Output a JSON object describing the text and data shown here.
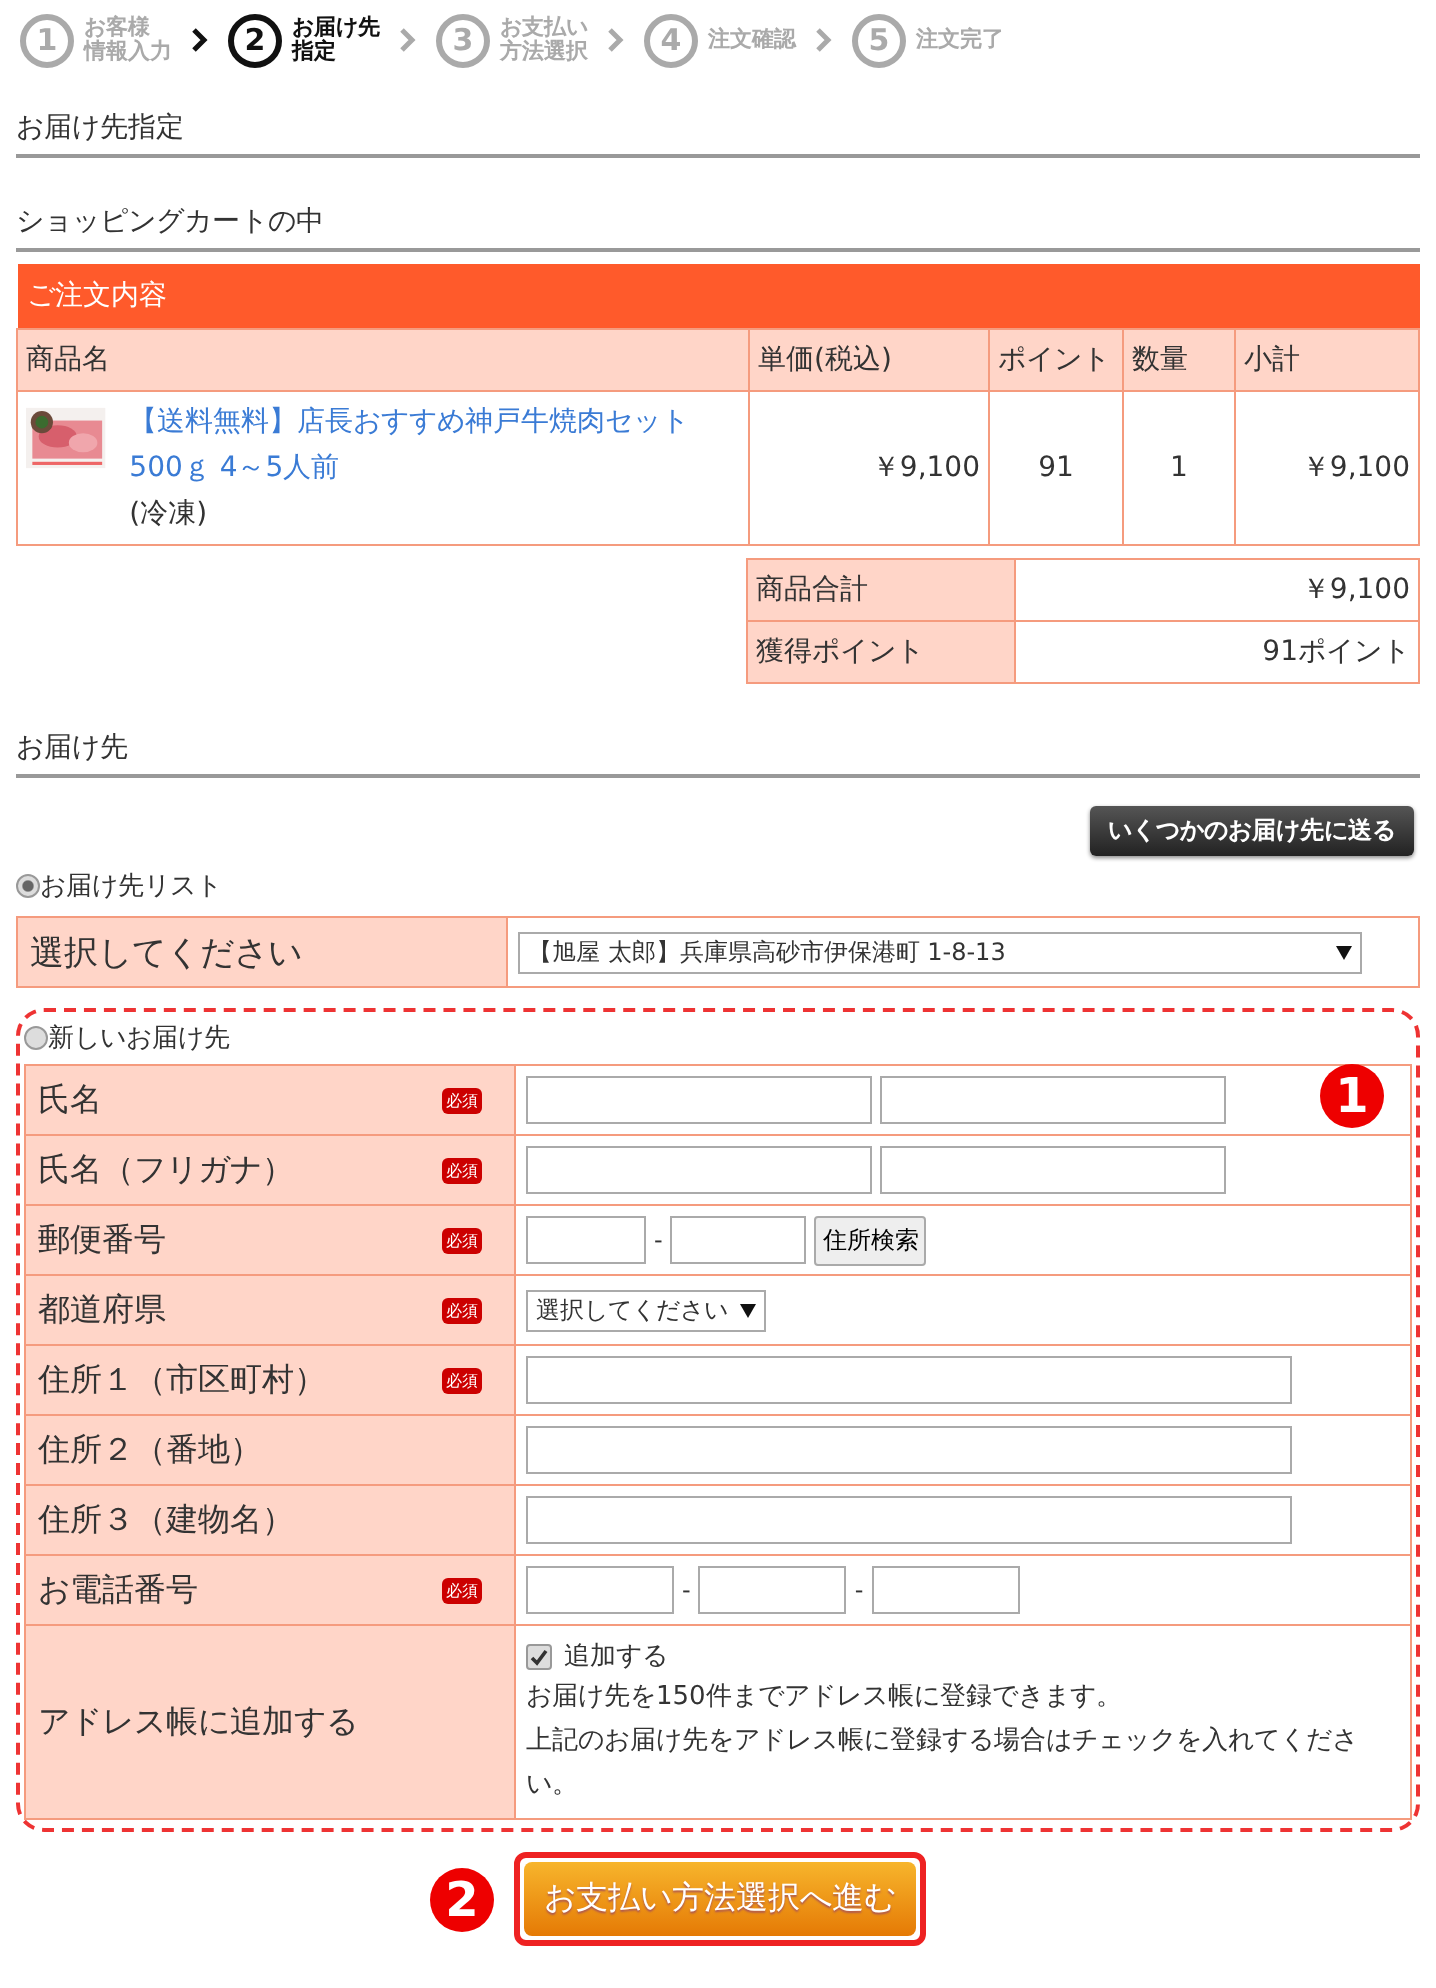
{
  "steps": [
    {
      "number": "1",
      "lines": [
        "お客様",
        "情報入力"
      ],
      "selected": false
    },
    {
      "number": "2",
      "lines": [
        "お届け先",
        "指定"
      ],
      "selected": true
    },
    {
      "number": "3",
      "lines": [
        "お支払い",
        "方法選択"
      ],
      "selected": false
    },
    {
      "number": "4",
      "lines": [
        "注文確認"
      ],
      "selected": false
    },
    {
      "number": "5",
      "lines": [
        "注文完了"
      ],
      "selected": false
    }
  ],
  "sections": [
    "お届け先指定",
    "ショッピングカートの中"
  ],
  "cart": {
    "title": "ご注文内容",
    "columns": [
      "商品名",
      "単価(税込)",
      "ポイント",
      "数量",
      "小計"
    ],
    "rows": [
      {
        "name": "【送料無料】店長おすすめ神戸牛焼肉セット500ｇ 4～5人前",
        "note": "(冷凍)",
        "price": "￥9,100",
        "points": "91",
        "quantity": "1",
        "subtotal": "￥9,100"
      }
    ],
    "summary": [
      {
        "label": "商品合計",
        "value": "￥9,100"
      },
      {
        "label": "獲得ポイント",
        "value": "91ポイント"
      }
    ]
  },
  "delivery": {
    "heading": "お届け先",
    "multi_button": "いくつかのお届け先に送る",
    "address_list": {
      "label": "お届け先リスト",
      "selected": true,
      "row_label": "選択してください",
      "value": "【旭屋 太郎】兵庫県高砂市伊保港町 1-8-13"
    },
    "new_address": {
      "label": "新しいお届け先",
      "selected": false,
      "marker": "1",
      "fields": [
        {
          "kind": "pair",
          "label": "氏名",
          "required": true,
          "badge": "必須"
        },
        {
          "kind": "pair",
          "label": "氏名（フリガナ）",
          "required": true,
          "badge": "必須"
        },
        {
          "kind": "zip",
          "label": "郵便番号",
          "required": true,
          "badge": "必須",
          "separators": [
            "-"
          ],
          "button": "住所検索"
        },
        {
          "kind": "select",
          "label": "都道府県",
          "required": true,
          "badge": "必須",
          "value": "選択してください"
        },
        {
          "kind": "text",
          "label": "住所１（市区町村）",
          "required": true,
          "badge": "必須"
        },
        {
          "kind": "text",
          "label": "住所２（番地）",
          "required": false
        },
        {
          "kind": "text",
          "label": "住所３（建物名）",
          "required": false
        },
        {
          "kind": "phone",
          "label": "お電話番号",
          "required": true,
          "badge": "必須",
          "separators": [
            "-",
            "-"
          ]
        }
      ],
      "address_book": {
        "label": "アドレス帳に追加する",
        "checkbox_label": "追加する",
        "checked": true,
        "notes": [
          "お届け先を150件までアドレス帳に登録できます。",
          "上記のお届け先をアドレス帳に登録する場合はチェックを入れてください。"
        ]
      }
    }
  },
  "next": {
    "marker": "2",
    "label": "お支払い方法選択へ進む"
  }
}
